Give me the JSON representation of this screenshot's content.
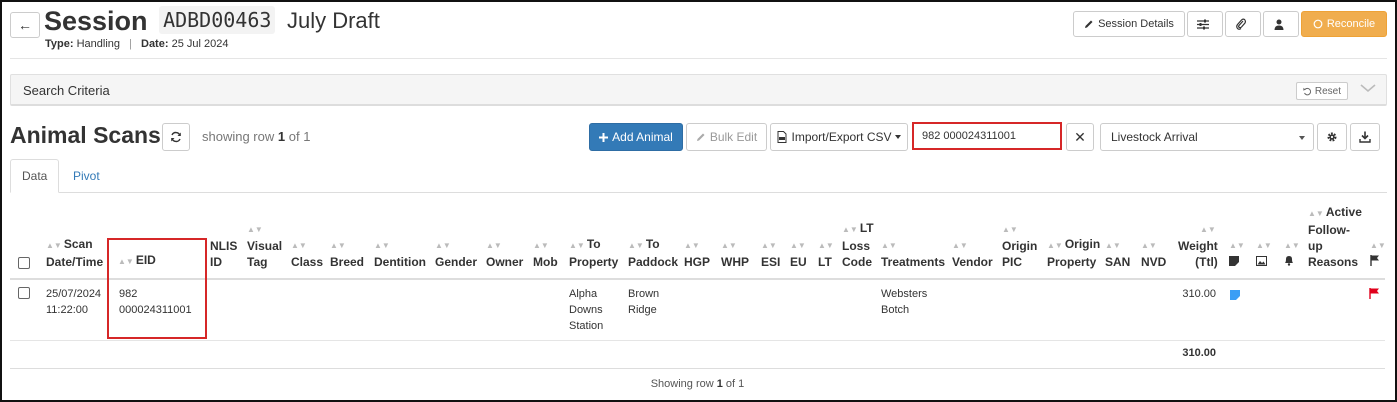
{
  "header": {
    "back_label": "←",
    "title_word": "Session",
    "session_code": "ADBD00463",
    "session_name": "July Draft",
    "type_label": "Type:",
    "type_value": "Handling",
    "date_label": "Date:",
    "date_value": "25 Jul 2024",
    "session_details_label": "Session Details",
    "reconcile_label": "Reconcile"
  },
  "search_criteria": {
    "title": "Search Criteria",
    "reset_label": "Reset"
  },
  "animal_scans": {
    "title": "Animal Scans",
    "showing_prefix": "showing row",
    "showing_row": "1",
    "showing_of": "of",
    "showing_total": "1",
    "add_animal_label": "Add Animal",
    "bulk_edit_label": "Bulk Edit",
    "import_export_label": "Import/Export CSV",
    "search_value": "982 000024311001",
    "clear_label": "✕",
    "view_select": "Livestock Arrival"
  },
  "tabs": [
    {
      "label": "Data"
    },
    {
      "label": "Pivot"
    }
  ],
  "table": {
    "columns": [
      [
        "Scan",
        "Date/Time"
      ],
      [
        "EID"
      ],
      [
        "NLIS",
        "ID"
      ],
      [
        "Visual",
        "Tag"
      ],
      [
        "Class"
      ],
      [
        "Breed"
      ],
      [
        "Dentition"
      ],
      [
        "Gender"
      ],
      [
        "Owner"
      ],
      [
        "Mob"
      ],
      [
        "To",
        "Property"
      ],
      [
        "To",
        "Paddock"
      ],
      [
        "HGP"
      ],
      [
        "WHP"
      ],
      [
        "ESI"
      ],
      [
        "EU"
      ],
      [
        "LT"
      ],
      [
        "LT",
        "Loss",
        "Code"
      ],
      [
        "Treatments"
      ],
      [
        "Vendor"
      ],
      [
        "Origin",
        "PIC"
      ],
      [
        "Origin",
        "Property"
      ],
      [
        "SAN"
      ],
      [
        "NVD"
      ],
      [
        "Weight",
        "(Ttl)"
      ],
      [
        "Active",
        "Follow-",
        "up",
        "Reasons"
      ]
    ],
    "row": {
      "scan_date": "25/07/2024",
      "scan_time": "11:22:00",
      "eid_1": "982",
      "eid_2": "000024311001",
      "to_property_1": "Alpha",
      "to_property_2": "Downs",
      "to_property_3": "Station",
      "to_paddock_1": "Brown",
      "to_paddock_2": "Ridge",
      "treatments_1": "Websters",
      "treatments_2": "Botch",
      "weight": "310.00"
    },
    "total_weight": "310.00",
    "footer_prefix": "Showing row",
    "footer_row": "1",
    "footer_of": "of",
    "footer_total": "1"
  },
  "colors": {
    "primary": "#337ab7",
    "reconcile": "#f0ad4e",
    "highlight": "#d62728",
    "note_icon": "#3a9ef5",
    "flag_icon": "#e0001b"
  }
}
